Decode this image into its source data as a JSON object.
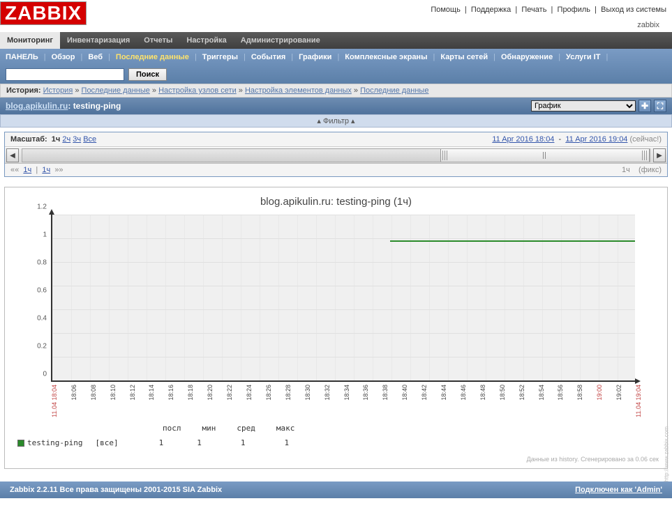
{
  "header": {
    "logo": "ZABBIX",
    "links": [
      "Помощь",
      "Поддержка",
      "Печать",
      "Профиль",
      "Выход из системы"
    ],
    "user": "zabbix"
  },
  "main_menu": {
    "tabs": [
      "Мониторинг",
      "Инвентаризация",
      "Отчеты",
      "Настройка",
      "Администрирование"
    ],
    "active": 0
  },
  "sub_menu": {
    "row1": [
      "ПАНЕЛЬ",
      "Обзор",
      "Веб",
      "Последние данные",
      "Триггеры",
      "События",
      "Графики"
    ],
    "row2": [
      "Комплексные экраны",
      "Карты сетей",
      "Обнаружение",
      "Услуги IT"
    ],
    "active_label": "Последние данные",
    "search_button": "Поиск",
    "search_placeholder": ""
  },
  "history": {
    "label": "История:",
    "items": [
      "История",
      "Последние данные",
      "Настройка узлов сети",
      "Настройка элементов данных",
      "Последние данные"
    ]
  },
  "title_bar": {
    "host_link": "blog.apikulin.ru",
    "sep": ": ",
    "item": "testing-ping",
    "view_select": "График"
  },
  "filter": {
    "label": "Фильтр"
  },
  "zoom": {
    "label": "Масштаб:",
    "current": "1ч",
    "options": [
      "2ч",
      "3ч",
      "Все"
    ],
    "range_from": "11 Apr 2016 18:04",
    "range_to": "11 Apr 2016 19:04",
    "now": "(сейчас!)",
    "nav_left": "««",
    "nav_left2": "1ч",
    "nav_mid": "1ч",
    "nav_rr": "»»",
    "dur": "1ч",
    "mode": "(фикс)"
  },
  "chart_data": {
    "type": "line",
    "title": "blog.apikulin.ru: testing-ping (1ч)",
    "ylim": [
      0,
      1.2
    ],
    "yticks": [
      0,
      0.2,
      0.4,
      0.6,
      0.8,
      1.0,
      1.2
    ],
    "x_start_label": "11.04 18:04",
    "x_end_label": "11.04 19:04",
    "x_labels": [
      "18:06",
      "18:08",
      "18:10",
      "18:12",
      "18:14",
      "18:16",
      "18:18",
      "18:20",
      "18:22",
      "18:24",
      "18:26",
      "18:28",
      "18:30",
      "18:32",
      "18:34",
      "18:36",
      "18:38",
      "18:40",
      "18:42",
      "18:44",
      "18:46",
      "18:48",
      "18:50",
      "18:52",
      "18:54",
      "18:56",
      "18:58",
      "19:00",
      "19:02"
    ],
    "red_xticks": [
      "19:00"
    ],
    "series": [
      {
        "name": "testing-ping",
        "agg": "[все]",
        "color": "#2a8a2a",
        "data_start_frac": 0.58,
        "data_end_frac": 1.0,
        "value": 1,
        "stats": {
          "посл": 1,
          "мин": 1,
          "сред": 1,
          "макс": 1
        }
      }
    ],
    "stats_headers": [
      "посл",
      "мин",
      "сред",
      "макс"
    ],
    "footer_note": "Данные из history. Сгенерировано за 0.06 сек",
    "watermark": "http://www.zabbix.com"
  },
  "footer": {
    "copyright": "Zabbix 2.2.11 Все права защищены 2001-2015 SIA Zabbix",
    "login": "Подключен как 'Admin'"
  }
}
